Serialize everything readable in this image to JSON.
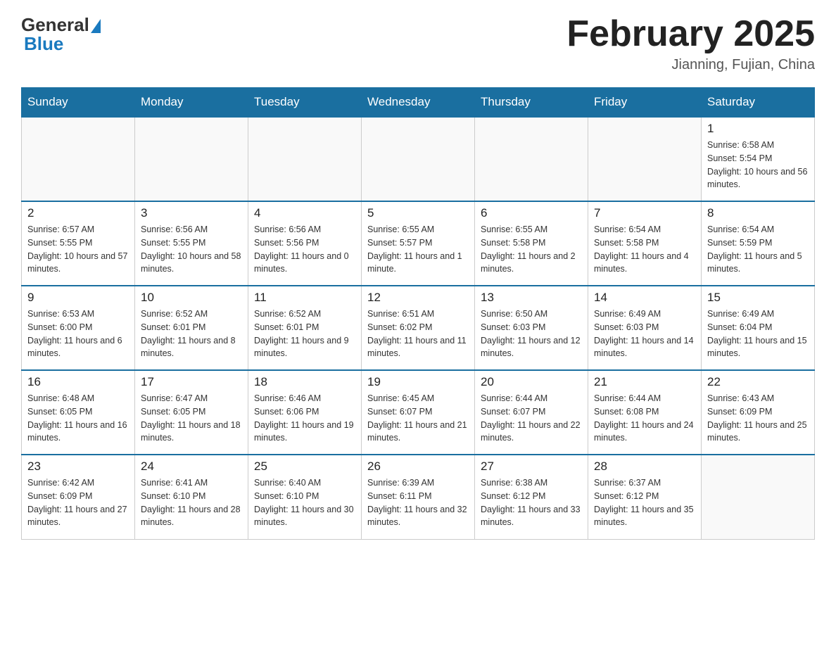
{
  "header": {
    "logo_general": "General",
    "logo_blue": "Blue",
    "month_year": "February 2025",
    "location": "Jianning, Fujian, China"
  },
  "days_of_week": [
    "Sunday",
    "Monday",
    "Tuesday",
    "Wednesday",
    "Thursday",
    "Friday",
    "Saturday"
  ],
  "weeks": [
    [
      {
        "day": "",
        "sunrise": "",
        "sunset": "",
        "daylight": ""
      },
      {
        "day": "",
        "sunrise": "",
        "sunset": "",
        "daylight": ""
      },
      {
        "day": "",
        "sunrise": "",
        "sunset": "",
        "daylight": ""
      },
      {
        "day": "",
        "sunrise": "",
        "sunset": "",
        "daylight": ""
      },
      {
        "day": "",
        "sunrise": "",
        "sunset": "",
        "daylight": ""
      },
      {
        "day": "",
        "sunrise": "",
        "sunset": "",
        "daylight": ""
      },
      {
        "day": "1",
        "sunrise": "Sunrise: 6:58 AM",
        "sunset": "Sunset: 5:54 PM",
        "daylight": "Daylight: 10 hours and 56 minutes."
      }
    ],
    [
      {
        "day": "2",
        "sunrise": "Sunrise: 6:57 AM",
        "sunset": "Sunset: 5:55 PM",
        "daylight": "Daylight: 10 hours and 57 minutes."
      },
      {
        "day": "3",
        "sunrise": "Sunrise: 6:56 AM",
        "sunset": "Sunset: 5:55 PM",
        "daylight": "Daylight: 10 hours and 58 minutes."
      },
      {
        "day": "4",
        "sunrise": "Sunrise: 6:56 AM",
        "sunset": "Sunset: 5:56 PM",
        "daylight": "Daylight: 11 hours and 0 minutes."
      },
      {
        "day": "5",
        "sunrise": "Sunrise: 6:55 AM",
        "sunset": "Sunset: 5:57 PM",
        "daylight": "Daylight: 11 hours and 1 minute."
      },
      {
        "day": "6",
        "sunrise": "Sunrise: 6:55 AM",
        "sunset": "Sunset: 5:58 PM",
        "daylight": "Daylight: 11 hours and 2 minutes."
      },
      {
        "day": "7",
        "sunrise": "Sunrise: 6:54 AM",
        "sunset": "Sunset: 5:58 PM",
        "daylight": "Daylight: 11 hours and 4 minutes."
      },
      {
        "day": "8",
        "sunrise": "Sunrise: 6:54 AM",
        "sunset": "Sunset: 5:59 PM",
        "daylight": "Daylight: 11 hours and 5 minutes."
      }
    ],
    [
      {
        "day": "9",
        "sunrise": "Sunrise: 6:53 AM",
        "sunset": "Sunset: 6:00 PM",
        "daylight": "Daylight: 11 hours and 6 minutes."
      },
      {
        "day": "10",
        "sunrise": "Sunrise: 6:52 AM",
        "sunset": "Sunset: 6:01 PM",
        "daylight": "Daylight: 11 hours and 8 minutes."
      },
      {
        "day": "11",
        "sunrise": "Sunrise: 6:52 AM",
        "sunset": "Sunset: 6:01 PM",
        "daylight": "Daylight: 11 hours and 9 minutes."
      },
      {
        "day": "12",
        "sunrise": "Sunrise: 6:51 AM",
        "sunset": "Sunset: 6:02 PM",
        "daylight": "Daylight: 11 hours and 11 minutes."
      },
      {
        "day": "13",
        "sunrise": "Sunrise: 6:50 AM",
        "sunset": "Sunset: 6:03 PM",
        "daylight": "Daylight: 11 hours and 12 minutes."
      },
      {
        "day": "14",
        "sunrise": "Sunrise: 6:49 AM",
        "sunset": "Sunset: 6:03 PM",
        "daylight": "Daylight: 11 hours and 14 minutes."
      },
      {
        "day": "15",
        "sunrise": "Sunrise: 6:49 AM",
        "sunset": "Sunset: 6:04 PM",
        "daylight": "Daylight: 11 hours and 15 minutes."
      }
    ],
    [
      {
        "day": "16",
        "sunrise": "Sunrise: 6:48 AM",
        "sunset": "Sunset: 6:05 PM",
        "daylight": "Daylight: 11 hours and 16 minutes."
      },
      {
        "day": "17",
        "sunrise": "Sunrise: 6:47 AM",
        "sunset": "Sunset: 6:05 PM",
        "daylight": "Daylight: 11 hours and 18 minutes."
      },
      {
        "day": "18",
        "sunrise": "Sunrise: 6:46 AM",
        "sunset": "Sunset: 6:06 PM",
        "daylight": "Daylight: 11 hours and 19 minutes."
      },
      {
        "day": "19",
        "sunrise": "Sunrise: 6:45 AM",
        "sunset": "Sunset: 6:07 PM",
        "daylight": "Daylight: 11 hours and 21 minutes."
      },
      {
        "day": "20",
        "sunrise": "Sunrise: 6:44 AM",
        "sunset": "Sunset: 6:07 PM",
        "daylight": "Daylight: 11 hours and 22 minutes."
      },
      {
        "day": "21",
        "sunrise": "Sunrise: 6:44 AM",
        "sunset": "Sunset: 6:08 PM",
        "daylight": "Daylight: 11 hours and 24 minutes."
      },
      {
        "day": "22",
        "sunrise": "Sunrise: 6:43 AM",
        "sunset": "Sunset: 6:09 PM",
        "daylight": "Daylight: 11 hours and 25 minutes."
      }
    ],
    [
      {
        "day": "23",
        "sunrise": "Sunrise: 6:42 AM",
        "sunset": "Sunset: 6:09 PM",
        "daylight": "Daylight: 11 hours and 27 minutes."
      },
      {
        "day": "24",
        "sunrise": "Sunrise: 6:41 AM",
        "sunset": "Sunset: 6:10 PM",
        "daylight": "Daylight: 11 hours and 28 minutes."
      },
      {
        "day": "25",
        "sunrise": "Sunrise: 6:40 AM",
        "sunset": "Sunset: 6:10 PM",
        "daylight": "Daylight: 11 hours and 30 minutes."
      },
      {
        "day": "26",
        "sunrise": "Sunrise: 6:39 AM",
        "sunset": "Sunset: 6:11 PM",
        "daylight": "Daylight: 11 hours and 32 minutes."
      },
      {
        "day": "27",
        "sunrise": "Sunrise: 6:38 AM",
        "sunset": "Sunset: 6:12 PM",
        "daylight": "Daylight: 11 hours and 33 minutes."
      },
      {
        "day": "28",
        "sunrise": "Sunrise: 6:37 AM",
        "sunset": "Sunset: 6:12 PM",
        "daylight": "Daylight: 11 hours and 35 minutes."
      },
      {
        "day": "",
        "sunrise": "",
        "sunset": "",
        "daylight": ""
      }
    ]
  ]
}
